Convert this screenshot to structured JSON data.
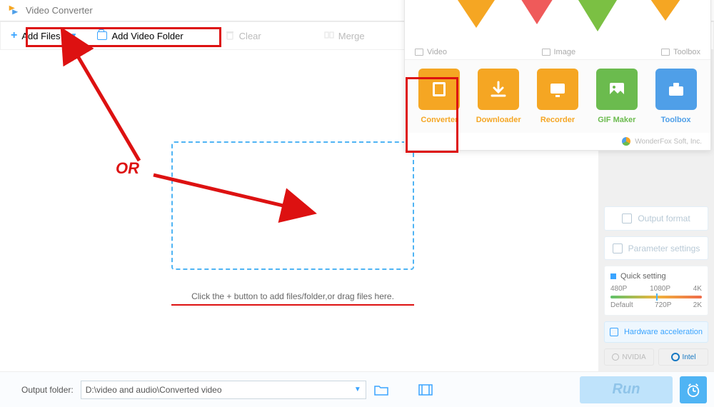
{
  "app": {
    "title": "Video Converter"
  },
  "toolbar": {
    "add_files": "Add Files",
    "add_folder": "Add Video Folder",
    "clear": "Clear",
    "merge": "Merge"
  },
  "drop": {
    "caption": "Click the + button to add files/folder,or drag files here."
  },
  "side": {
    "output_format_btn": "Output format",
    "param_btn": "Parameter settings",
    "quick_setting": "Quick setting",
    "res": {
      "a": "480P",
      "b": "1080P",
      "c": "4K",
      "d": "Default",
      "e": "720P",
      "f": "2K"
    },
    "hw": "Hardware acceleration",
    "nvidia": "NVIDIA",
    "intel": "Intel"
  },
  "footer": {
    "label": "Output folder:",
    "path": "D:\\video and audio\\Converted video",
    "run": "Run"
  },
  "popup": {
    "cats": {
      "video": "Video",
      "image": "Image",
      "toolbox": "Toolbox"
    },
    "mods": {
      "converter": "Converter",
      "downloader": "Downloader",
      "recorder": "Recorder",
      "gif": "GIF Maker",
      "toolbox": "Toolbox"
    },
    "copyright": "WonderFox Soft, Inc."
  },
  "annot": {
    "or": "OR"
  }
}
